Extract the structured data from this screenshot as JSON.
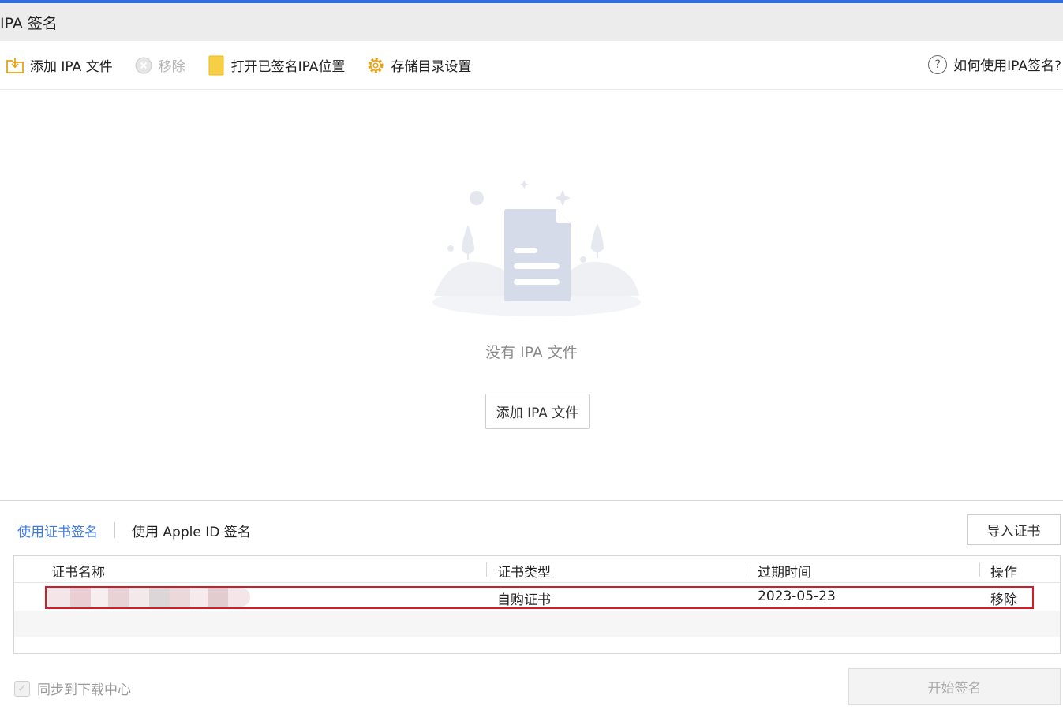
{
  "window": {
    "title": "IPA 签名"
  },
  "toolbar": {
    "add_ipa": "添加 IPA 文件",
    "remove": "移除",
    "open_signed_location": "打开已签名IPA位置",
    "storage_settings": "存储目录设置",
    "help": "如何使用IPA签名?"
  },
  "empty_state": {
    "message": "没有 IPA 文件",
    "add_button": "添加 IPA 文件"
  },
  "sign_tabs": {
    "active": "使用证书签名",
    "other": "使用 Apple ID 签名"
  },
  "import_button": "导入证书",
  "table": {
    "columns": [
      "证书名称",
      "证书类型",
      "过期时间",
      "操作"
    ],
    "rows": [
      {
        "name": "",
        "type": "自购证书",
        "expires": "2023-05-23",
        "action": "移除"
      }
    ]
  },
  "sync_checkbox": {
    "label": "同步到下载中心",
    "checked": true,
    "disabled": true
  },
  "start_button": "开始签名",
  "colors": {
    "accent": "#3d79e8",
    "highlight": "#d11f2a",
    "folder": "#f5c518",
    "gear": "#e8a317"
  }
}
